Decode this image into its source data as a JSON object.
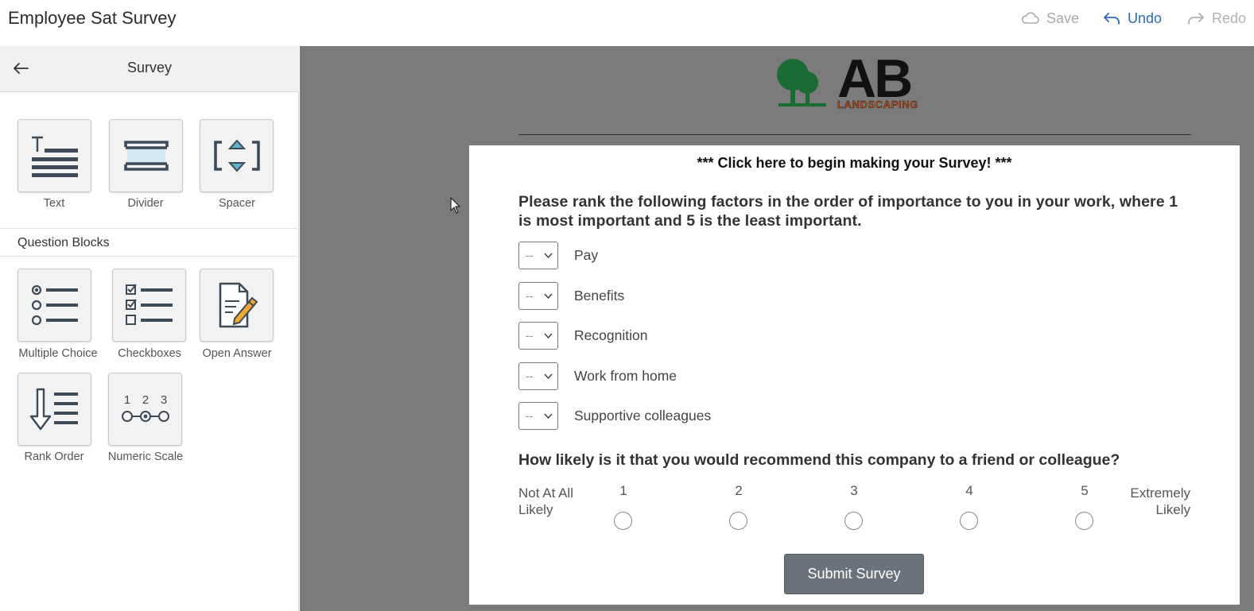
{
  "app": {
    "title": "Employee Sat Survey"
  },
  "toolbar": {
    "save_label": "Save",
    "undo_label": "Undo",
    "redo_label": "Redo"
  },
  "sidebar": {
    "title": "Survey",
    "content_blocks": [
      {
        "label": "Text",
        "icon": "text-block-icon"
      },
      {
        "label": "Divider",
        "icon": "divider-block-icon"
      },
      {
        "label": "Spacer",
        "icon": "spacer-block-icon"
      }
    ],
    "section_title": "Question Blocks",
    "question_blocks": [
      {
        "label": "Multiple Choice",
        "icon": "multiple-choice-icon"
      },
      {
        "label": "Checkboxes",
        "icon": "checkboxes-icon"
      },
      {
        "label": "Open Answer",
        "icon": "open-answer-icon"
      },
      {
        "label": "Rank Order",
        "icon": "rank-order-icon"
      },
      {
        "label": "Numeric Scale",
        "icon": "numeric-scale-icon"
      }
    ],
    "numeric_scale_icon_digits": [
      "1",
      "2",
      "3"
    ]
  },
  "logo": {
    "main": "AB",
    "sub": "LANDSCAPING",
    "icon": "tree-logo-icon",
    "colors": {
      "tree": "#1b6b34",
      "letters": "#111111",
      "sub": "#c0501d"
    }
  },
  "survey": {
    "click_prompt": "*** Click here to begin making your Survey! ***",
    "question1": {
      "text": "Please rank the following factors in the order of importance to you in your work, where 1 is most important and 5 is the least important.",
      "select_placeholder": "--",
      "items": [
        "Pay",
        "Benefits",
        "Recognition",
        "Work from home",
        "Supportive colleagues"
      ]
    },
    "question2": {
      "text": "How likely is it that you would recommend this company to a friend or colleague?",
      "low_label": "Not At All Likely",
      "high_label": "Extremely Likely",
      "scale": [
        "1",
        "2",
        "3",
        "4",
        "5"
      ]
    },
    "submit_label": "Submit Survey"
  },
  "colors": {
    "accent": "#2b6cb0",
    "canvas_bg": "#7b7b7b",
    "submit_bg": "#6b737a",
    "sidebar_header_bg": "#eef0f2"
  }
}
